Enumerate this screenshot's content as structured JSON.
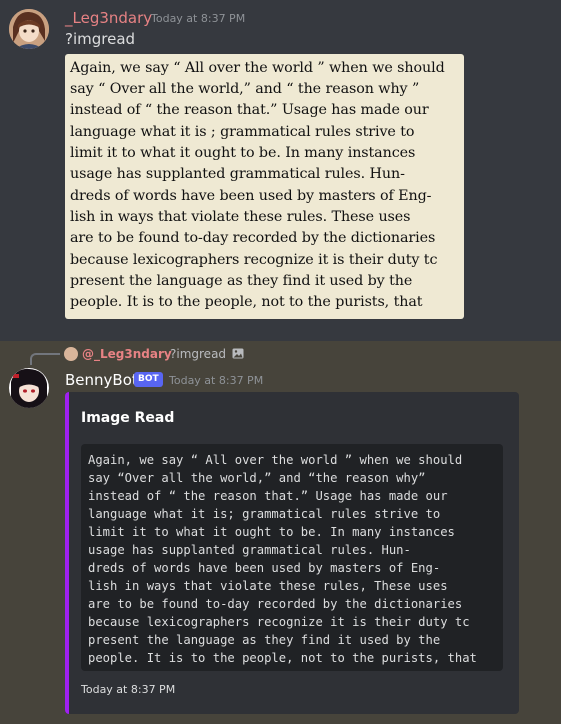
{
  "message1": {
    "username": "_Leg3ndary",
    "timestamp": "Today at 8:37 PM",
    "content": "?imgread",
    "scan_lines": [
      "Again, we say “ All over the world ” when we should",
      "say “ Over all the world,” and “ the reason why ”",
      "instead of “ the reason that.” Usage has made our",
      "language what it is ; grammatical rules strive to",
      "limit it to what it ought to be. In many instances",
      "usage has supplanted grammatical rules. Hun-",
      "dreds of words have been used by masters of Eng-",
      "lish in ways that violate these rules. These uses",
      "are to be found to-day recorded by the dictionaries",
      "because lexicographers recognize it is their duty tc",
      "present the language as they find it used by the",
      "people. It is to the people, not to the purists, that"
    ]
  },
  "message2": {
    "reply": {
      "username": "@_Leg3ndary",
      "content": "?imgread",
      "icon": "image-icon"
    },
    "username": "BennyBot",
    "badge": "BOT",
    "timestamp": "Today at 8:37 PM",
    "embed": {
      "accent_color": "#a020f0",
      "title": "Image Read",
      "code_lines": [
        "Again, we say “ All over the world ” when we should",
        "say “Over all the world,” and “the reason why”",
        "instead of “ the reason that.” Usage has made our",
        "language what it is; grammatical rules strive to",
        "limit it to what it ought to be. In many instances",
        "usage has supplanted grammatical rules. Hun-",
        "dreds of words have been used by masters of Eng-",
        "lish in ways that violate these rules, These uses",
        "are to be found to-day recorded by the dictionaries",
        "because lexicographers recognize it is their duty tc",
        "present the language as they find it used by the",
        "people. It is to the people, not to the purists, that"
      ],
      "footer": "Today at 8:37 PM"
    }
  }
}
